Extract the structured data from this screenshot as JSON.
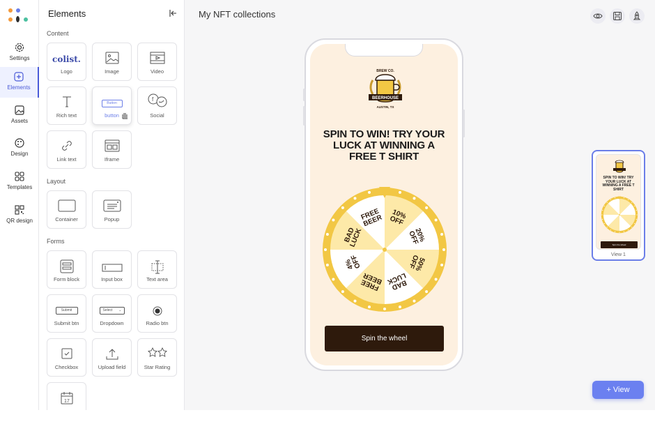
{
  "app": {
    "title": "My NFT collections"
  },
  "rail": {
    "items": [
      {
        "label": "Settings"
      },
      {
        "label": "Elements"
      },
      {
        "label": "Assets"
      },
      {
        "label": "Design"
      },
      {
        "label": "Templates"
      },
      {
        "label": "QR design"
      }
    ]
  },
  "panel": {
    "title": "Elements",
    "sections": {
      "content": "Content",
      "layout": "Layout",
      "forms": "Forms"
    },
    "content_items": [
      "Logo",
      "Image",
      "Video",
      "Rich text",
      "button",
      "Social",
      "Link text",
      "Iframe"
    ],
    "layout_items": [
      "Container",
      "Popup"
    ],
    "form_items": [
      "Form block",
      "Input box",
      "Text area",
      "Submit btn",
      "Dropdown",
      "Radio btn",
      "Checkbox",
      "Upload field",
      "Star Rating"
    ],
    "logo_tile_text": "colist.",
    "button_tile_text": "Button",
    "submit_tile_text": "Submit",
    "select_tile_text": "Select"
  },
  "canvas": {
    "brand_top": "BREW CO.",
    "brand_name": "BEERHOUSE",
    "brand_location": "AUSTIN, TX",
    "promo_title": "SPIN TO WIN! TRY YOUR LUCK AT WINNING A FREE T SHIRT",
    "wheel_segments": [
      "10% OFF",
      "20% OFF",
      "50% OFF",
      "BAD LUCK",
      "FREE BEER",
      "4% OFF",
      "BAD LUCK",
      "FREE BEER"
    ],
    "spin_button": "Spin the wheel"
  },
  "preview": {
    "label": "View 1",
    "title": "SPIN TO WIN! TRY YOUR LUCK AT WINNING A FREE T SHIRT",
    "button": "Spin the wheel"
  },
  "add_view_button": "+ View",
  "colors": {
    "accent": "#4b5bd8",
    "wheel_gold": "#f2c744",
    "wheel_light": "#fde9a8",
    "button_dark": "#2e1a0c",
    "canvas_bg": "#fdf0e0"
  }
}
